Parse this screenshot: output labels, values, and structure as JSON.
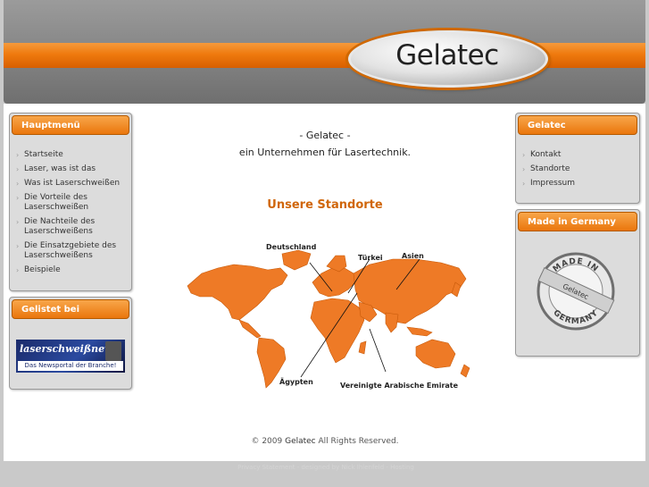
{
  "header": {
    "logo_text": "Gelatec"
  },
  "left": {
    "menu_title": "Hauptmenü",
    "menu_items": [
      "Startseite",
      "Laser, was ist das",
      "Was ist Laserschweißen",
      "Die Vorteile des Laserschweißen",
      "Die Nachteile des Laserschweißens",
      "Die Einsatzgebiete des Laserschweißens",
      "Beispiele"
    ],
    "listed_title": "Gelistet bei",
    "banner": {
      "title": "laserschweißnews",
      "subtitle": "Das Newsportal der Branche!"
    }
  },
  "main": {
    "intro_line1": "- Gelatec -",
    "intro_line2": "ein Unternehmen für Lasertechnik.",
    "map_title": "Unsere Standorte",
    "labels": {
      "deutschland": "Deutschland",
      "tuerkei": "Türkei",
      "asien": "Asien",
      "aegypten": "Ägypten",
      "vae": "Vereinigte Arabische Emirate"
    },
    "footer_prefix": "© 2009",
    "footer_brand": "Gelatec",
    "footer_suffix": "All Rights Reserved."
  },
  "right": {
    "gelatec_title": "Gelatec",
    "links": [
      "Kontakt",
      "Standorte",
      "Impressum"
    ],
    "made_title": "Made in Germany",
    "seal": {
      "top": "MADE IN",
      "center": "Gelatec",
      "bottom": "GERMANY"
    }
  },
  "bottom_line": "Privacy Statement - designed by Nick Ihlenfeld - Hosting",
  "colors": {
    "accent": "#ef7a0e",
    "header_gray": "#8c8c8c",
    "map": "#ee7a26"
  }
}
